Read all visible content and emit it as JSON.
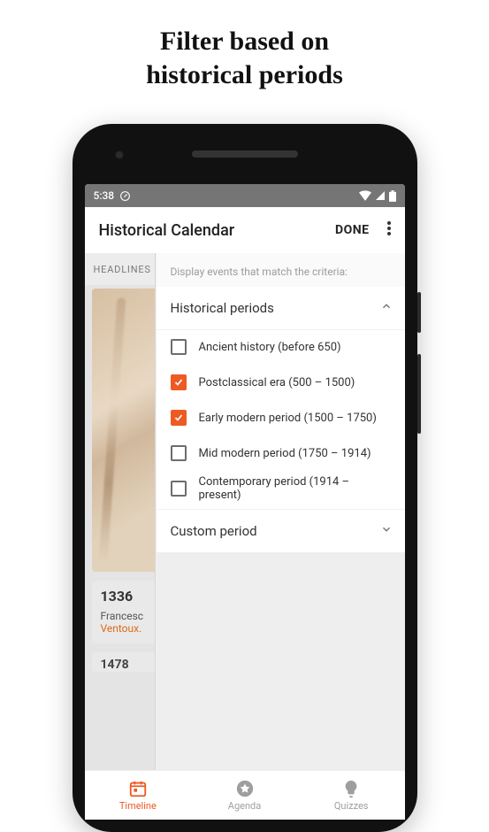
{
  "promo": {
    "title_line1": "Filter based on",
    "title_line2": "historical periods"
  },
  "statusbar": {
    "time": "5:38"
  },
  "appbar": {
    "title": "Historical Calendar",
    "done": "DONE"
  },
  "bg": {
    "tab": "HEADLINES",
    "card1_year": "1336",
    "card1_line1": "Francesc",
    "card1_line2": "Ventoux.",
    "card2_year": "1478"
  },
  "panel": {
    "caption": "Display events that match the criteria:",
    "section1_title": "Historical periods",
    "options": [
      {
        "label": "Ancient history (before 650)",
        "checked": false
      },
      {
        "label": "Postclassical era (500 – 1500)",
        "checked": true
      },
      {
        "label": "Early modern period (1500 – 1750)",
        "checked": true
      },
      {
        "label": "Mid modern period (1750 – 1914)",
        "checked": false
      },
      {
        "label": "Contemporary period (1914 – present)",
        "checked": false
      }
    ],
    "section2_title": "Custom period"
  },
  "bottomnav": {
    "items": [
      {
        "label": "Timeline"
      },
      {
        "label": "Agenda"
      },
      {
        "label": "Quizzes"
      }
    ]
  }
}
